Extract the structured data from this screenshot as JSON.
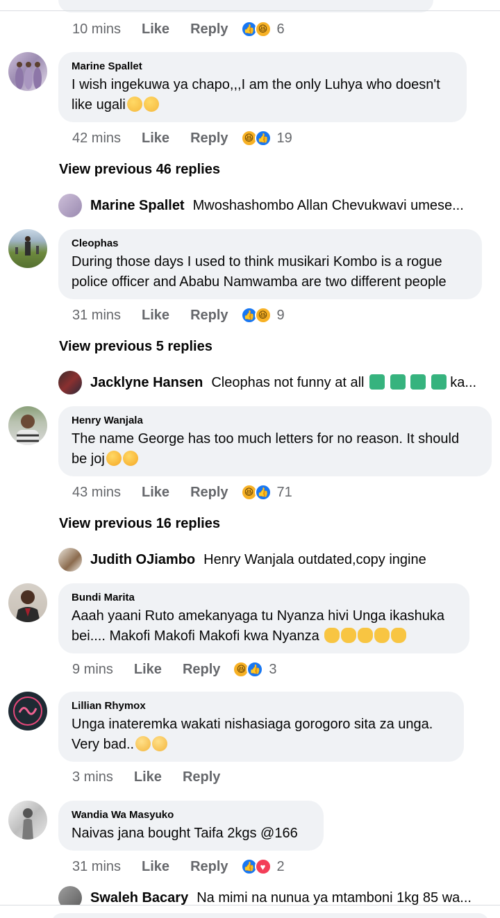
{
  "top_comment": {
    "time": "10 mins",
    "like": "Like",
    "reply": "Reply",
    "reactions": [
      "like",
      "haha"
    ],
    "count": "6"
  },
  "comments": [
    {
      "name": "Marine Spallet",
      "text": "I wish ingekuwa ya chapo,,,I am the only Luhya who doesn't like ugali",
      "emojis": [
        "weary",
        "weary"
      ],
      "time": "42 mins",
      "like": "Like",
      "reply": "Reply",
      "reactions": [
        "haha",
        "like"
      ],
      "count": "19"
    },
    {
      "name": "Cleophas",
      "text": "During those days I used to think musikari Kombo is a rogue police officer and Ababu Namwamba are two different people",
      "emojis": [],
      "time": "31 mins",
      "like": "Like",
      "reply": "Reply",
      "reactions": [
        "like",
        "haha"
      ],
      "count": "9"
    },
    {
      "name": "Henry Wanjala",
      "text": "The name George has too much letters for no reason. It should be joj",
      "emojis": [
        "squint",
        "squint"
      ],
      "time": "43 mins",
      "like": "Like",
      "reply": "Reply",
      "reactions": [
        "haha",
        "like"
      ],
      "count": "71"
    },
    {
      "name": "Bundi Marita",
      "text": "Aaah yaani Ruto amekanyaga tu Nyanza hivi Unga ikashuka bei.... Makofi Makofi Makofi kwa Nyanza",
      "emojis": [
        "clap",
        "clap",
        "clap",
        "clap",
        "clap"
      ],
      "time": "9 mins",
      "like": "Like",
      "reply": "Reply",
      "reactions": [
        "haha",
        "like"
      ],
      "count": "3"
    },
    {
      "name": "Lillian Rhymox",
      "text": "Unga inateremka wakati nishasiaga gorogoro sita za unga. Very bad..",
      "emojis": [
        "sleepy",
        "sleepy"
      ],
      "time": "3 mins",
      "like": "Like",
      "reply": "Reply",
      "reactions": [],
      "count": ""
    },
    {
      "name": "Wandia Wa Masyuko",
      "text": "Naivas jana bought Taifa 2kgs @166",
      "emojis": [],
      "time": "31 mins",
      "like": "Like",
      "reply": "Reply",
      "reactions": [
        "like",
        "love"
      ],
      "count": "2"
    }
  ],
  "view_previous": [
    "View previous 46 replies",
    "View previous 5 replies",
    "View previous 16 replies"
  ],
  "replies": [
    {
      "name": "Marine Spallet",
      "text": "Mwoshashombo Allan Chevukwavi umese..."
    },
    {
      "name": "Jacklyne Hansen",
      "text": "Cleophas not funny at all",
      "trail": "ka..."
    },
    {
      "name": "Judith OJiambo",
      "text": "Henry Wanjala outdated,copy ingine"
    },
    {
      "name": "Swaleh Bacary",
      "text": "Na mimi na nunua ya mtamboni 1kg 85 wa..."
    }
  ],
  "colors": {
    "bubble": "#f0f2f5",
    "meta": "#65676b",
    "like": "#1877f2",
    "haha": "#f7b125",
    "love": "#f33e58"
  }
}
